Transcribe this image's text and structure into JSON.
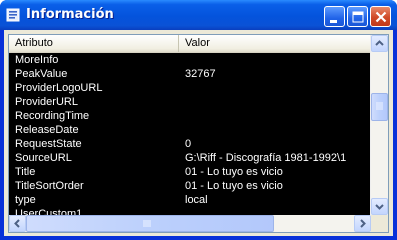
{
  "window": {
    "title": "Información",
    "controls": {
      "minimize_icon": "minimize-icon",
      "maximize_icon": "maximize-icon",
      "close_icon": "close-icon"
    }
  },
  "colors": {
    "titlebar": "#0453dc",
    "list_background": "#000000",
    "list_text": "#ffffff",
    "header_background": "#ece9d8"
  },
  "list": {
    "columns": [
      {
        "label": "Atributo"
      },
      {
        "label": "Valor"
      }
    ],
    "rows": [
      {
        "attribute": "MoreInfo",
        "value": ""
      },
      {
        "attribute": "PeakValue",
        "value": "32767"
      },
      {
        "attribute": "ProviderLogoURL",
        "value": ""
      },
      {
        "attribute": "ProviderURL",
        "value": ""
      },
      {
        "attribute": "RecordingTime",
        "value": ""
      },
      {
        "attribute": "ReleaseDate",
        "value": ""
      },
      {
        "attribute": "RequestState",
        "value": "0"
      },
      {
        "attribute": "SourceURL",
        "value": "G:\\Riff - Discografía 1981-1992\\1"
      },
      {
        "attribute": "Title",
        "value": "01 - Lo tuyo es vicio"
      },
      {
        "attribute": "TitleSortOrder",
        "value": "01 - Lo tuyo es vicio"
      },
      {
        "attribute": "type",
        "value": "local"
      },
      {
        "attribute": "UserCustom1",
        "value": ""
      }
    ]
  }
}
